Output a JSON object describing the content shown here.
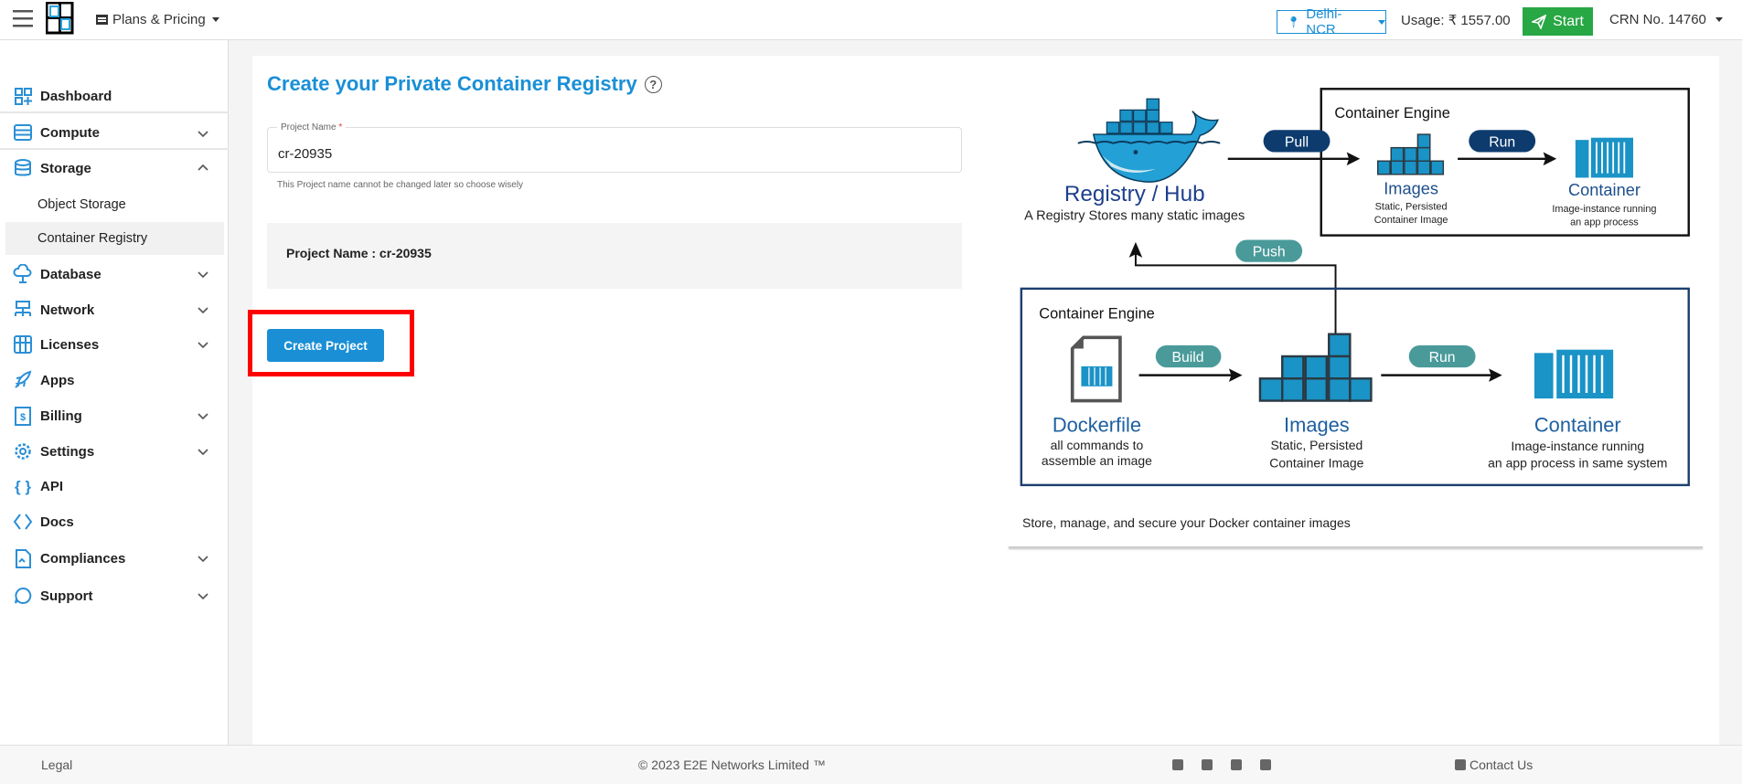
{
  "header": {
    "plans_label": "Plans & Pricing",
    "region": "Delhi-NCR",
    "usage_label": "Usage:",
    "usage_value": "₹ 1557.00",
    "start_label": "Start",
    "crn_label": "CRN No. 14760",
    "logo_text": "E2E Networks"
  },
  "sidebar": {
    "items": [
      {
        "label": "Dashboard",
        "icon": "dashboard-icon"
      },
      {
        "label": "Compute",
        "icon": "server-icon",
        "chevron": "down"
      },
      {
        "label": "Storage",
        "icon": "database-icon",
        "chevron": "up"
      },
      {
        "label": "Object Storage"
      },
      {
        "label": "Container Registry",
        "active": true
      },
      {
        "label": "Database",
        "icon": "cloud-database-icon",
        "chevron": "down"
      },
      {
        "label": "Network",
        "icon": "network-icon",
        "chevron": "down"
      },
      {
        "label": "Licenses",
        "icon": "licenses-icon",
        "chevron": "down"
      },
      {
        "label": "Apps",
        "icon": "rocket-icon"
      },
      {
        "label": "Billing",
        "icon": "billing-icon",
        "chevron": "down"
      },
      {
        "label": "Settings",
        "icon": "gear-icon",
        "chevron": "down"
      },
      {
        "label": "API",
        "icon": "braces-icon"
      },
      {
        "label": "Docs",
        "icon": "code-icon"
      },
      {
        "label": "Compliances",
        "icon": "document-icon",
        "chevron": "down"
      },
      {
        "label": "Support",
        "icon": "support-icon",
        "chevron": "down"
      }
    ]
  },
  "main": {
    "title": "Create your Private Container Registry",
    "field_label": "Project Name",
    "required_mark": "*",
    "field_value": "cr-20935",
    "helper": "This Project name cannot be changed later so choose wisely",
    "summary": "Project Name : cr-20935",
    "create_button": "Create Project"
  },
  "diagram": {
    "registry_title": "Registry / Hub",
    "registry_caption": "A Registry Stores many static images",
    "engine_label_top": "Container Engine",
    "engine_label_bottom": "Container Engine",
    "pull": "Pull",
    "push": "Push",
    "build": "Build",
    "run_top": "Run",
    "run_bottom": "Run",
    "images_top": "Images",
    "images_top_sub1": "Static, Persisted",
    "images_top_sub2": "Container Image",
    "container_top": "Container",
    "container_top_sub1": "Image-instance running",
    "container_top_sub2": "an app process",
    "dockerfile": "Dockerfile",
    "dockerfile_sub1": "all commands to",
    "dockerfile_sub2": "assemble an image",
    "images_bottom": "Images",
    "images_bottom_sub1": "Static, Persisted",
    "images_bottom_sub2": "Container Image",
    "container_bottom": "Container",
    "container_bottom_sub1": "Image-instance running",
    "container_bottom_sub2": "an app process in same system",
    "caption": "Store, manage, and secure your Docker container images"
  },
  "footer": {
    "legal": "Legal",
    "copyright": "© 2023 E2E Networks Limited ™",
    "contact": "Contact Us",
    "social": [
      "linkedin-icon",
      "facebook-icon",
      "twitter-icon",
      "rss-icon"
    ]
  },
  "colors": {
    "accent": "#1a8fd6",
    "start": "#28a745",
    "highlight": "#ff0000",
    "pill_dark": "#0d3b6e",
    "pill_teal": "#4a9a9a"
  }
}
